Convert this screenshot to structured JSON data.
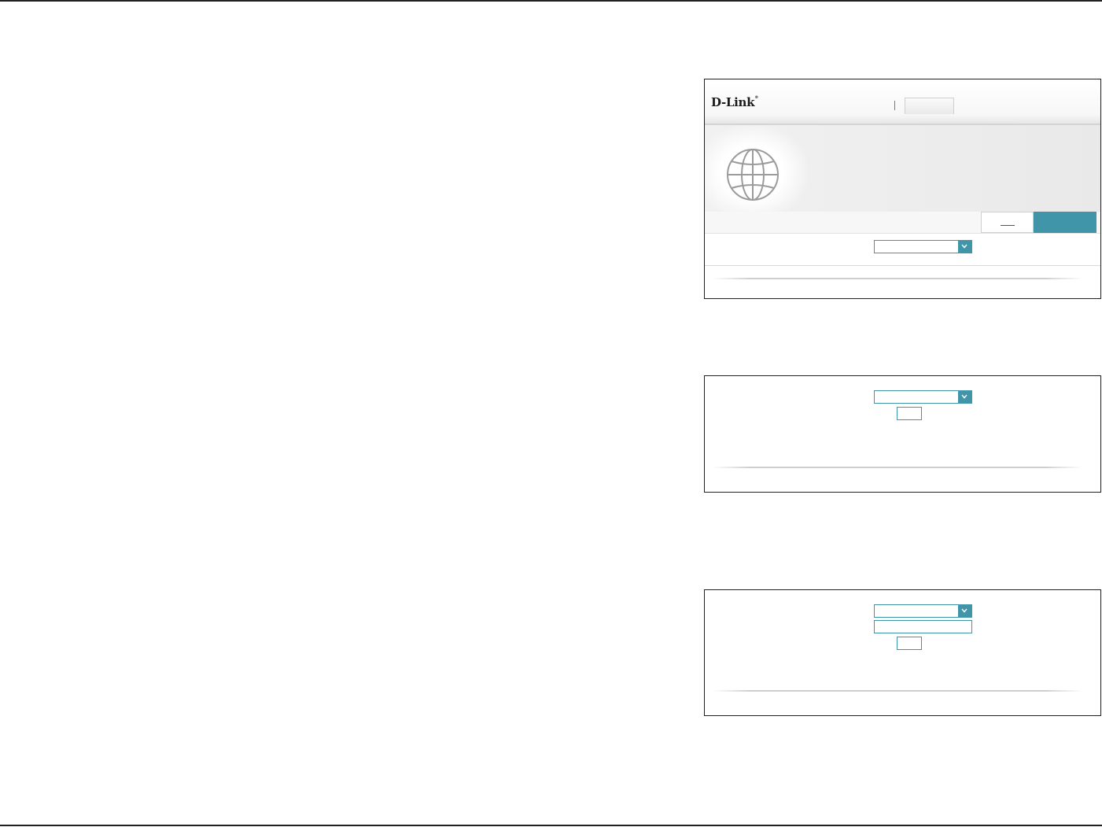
{
  "brand": {
    "logo_text": "D-Link",
    "logo_mark": "®"
  },
  "header": {
    "tab_label": ""
  },
  "banner": {
    "icon": "globe-icon"
  },
  "actions": {
    "secondary_label": "",
    "primary_label": ""
  },
  "panel1": {
    "select_value": ""
  },
  "panel2": {
    "select_value": "",
    "button_label": ""
  },
  "panel3": {
    "select_value": "",
    "input_value": "",
    "button_label": ""
  },
  "colors": {
    "accent": "#4095a8",
    "border": "#231f20"
  }
}
